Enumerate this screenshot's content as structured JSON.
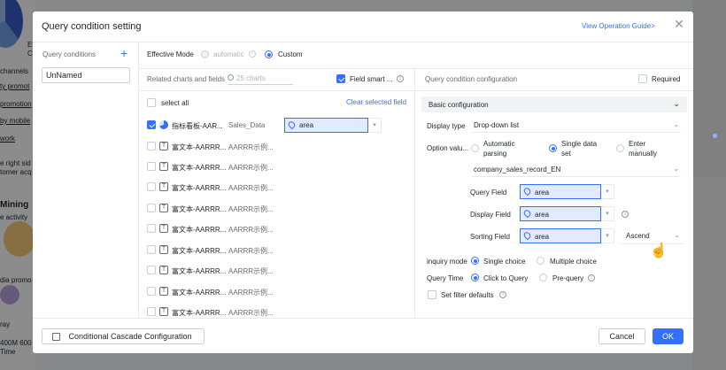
{
  "background": {
    "left_items": [
      "E",
      "C",
      "channels",
      "ty promot",
      "promotion",
      "by mobile",
      "work",
      "e right sid",
      "tomer acq",
      "Mining",
      "e activity",
      "dia promo",
      "ray",
      "400M 600",
      "Time"
    ]
  },
  "dialog": {
    "title": "Query condition setting",
    "guide_link": "View Operation Guide>",
    "close_icon": "close-icon"
  },
  "query_conditions": {
    "label": "Query conditions",
    "add_icon": "+",
    "items": [
      "UnNamed"
    ]
  },
  "effective_mode": {
    "label": "Effective Mode",
    "options": [
      "automatic",
      "Custom"
    ],
    "selected": "Custom"
  },
  "related": {
    "label": "Related charts and fields",
    "search_placeholder": "25 charts",
    "field_smart_label": "Field smart ...",
    "select_all": "select all",
    "clear_selected": "Clear selected field",
    "rows": [
      {
        "name": "指标看板-AAR...",
        "source": "Sales_Data",
        "checked": true,
        "icon": "pie-chart-icon",
        "field": "area"
      },
      {
        "name": "富文本-AARRR...",
        "source": "AARRR示例...",
        "checked": false,
        "icon": "text-icon"
      },
      {
        "name": "富文本-AARRR...",
        "source": "AARRR示例...",
        "checked": false,
        "icon": "text-icon"
      },
      {
        "name": "富文本-AARRR...",
        "source": "AARRR示例...",
        "checked": false,
        "icon": "text-icon"
      },
      {
        "name": "富文本-AARRR...",
        "source": "AARRR示例...",
        "checked": false,
        "icon": "text-icon"
      },
      {
        "name": "富文本-AARRR...",
        "source": "AARRR示例...",
        "checked": false,
        "icon": "text-icon"
      },
      {
        "name": "富文本-AARRR...",
        "source": "AARRR示例...",
        "checked": false,
        "icon": "text-icon"
      },
      {
        "name": "富文本-AARRR...",
        "source": "AARRR示例...",
        "checked": false,
        "icon": "text-icon"
      },
      {
        "name": "富文本-AARRR...",
        "source": "AARRR示例...",
        "checked": false,
        "icon": "text-icon"
      },
      {
        "name": "富文本-AARRR...",
        "source": "AARRR示例...",
        "checked": false,
        "icon": "text-icon"
      }
    ]
  },
  "config": {
    "label": "Query condition configuration",
    "required_label": "Required",
    "section": "Basic configuration",
    "display_type_label": "Display type",
    "display_type_value": "Drop-down list",
    "option_value_label": "Option valu...",
    "option_auto": "Automatic parsing",
    "option_single": "Single data set",
    "option_manual": "Enter manually",
    "dataset": "company_sales_record_EN",
    "query_field_label": "Query Field",
    "query_field_value": "area",
    "display_field_label": "Display Field",
    "display_field_value": "area",
    "sorting_field_label": "Sorting Field",
    "sorting_field_value": "area",
    "sort_order": "Ascend",
    "inquiry_mode_label": "inquiry mode",
    "inquiry_single": "Single choice",
    "inquiry_multiple": "Multiple choice",
    "query_time_label": "Query Time",
    "query_click": "Click to Query",
    "query_pre": "Pre-query",
    "filter_defaults": "Set filter defaults"
  },
  "footer": {
    "cascade_button": "Conditional Cascade Configuration",
    "cancel": "Cancel",
    "ok": "OK"
  }
}
